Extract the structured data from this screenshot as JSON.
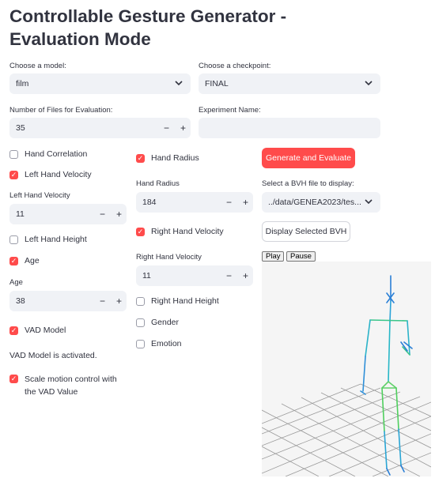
{
  "title": "Controllable Gesture Generator - Evaluation Mode",
  "model": {
    "label": "Choose a model:",
    "value": "film"
  },
  "checkpoint": {
    "label": "Choose a checkpoint:",
    "value": "FINAL"
  },
  "num_files": {
    "label": "Number of Files for Evaluation:",
    "value": "35"
  },
  "experiment": {
    "label": "Experiment Name:",
    "value": ""
  },
  "col1": {
    "hand_correlation": "Hand Correlation",
    "left_hand_velocity": "Left Hand Velocity",
    "left_hand_velocity_input_label": "Left Hand Velocity",
    "left_hand_velocity_value": "11",
    "left_hand_height": "Left Hand Height",
    "age": "Age",
    "age_input_label": "Age",
    "age_value": "38",
    "vad_model": "VAD Model",
    "vad_status": "VAD Model is activated.",
    "scale_line1": "Scale motion control with",
    "scale_line2": "the VAD Value"
  },
  "col2": {
    "hand_radius": "Hand Radius",
    "hand_radius_input_label": "Hand Radius",
    "hand_radius_value": "184",
    "right_hand_velocity": "Right Hand Velocity",
    "right_hand_velocity_input_label": "Right Hand Velocity",
    "right_hand_velocity_value": "11",
    "right_hand_height": "Right Hand Height",
    "gender": "Gender",
    "emotion": "Emotion"
  },
  "col3": {
    "generate_button": "Generate and Evaluate",
    "bvh_label": "Select a BVH file to display:",
    "bvh_value": "../data/GENEA2023/tes...",
    "display_button": "Display Selected BVH",
    "play": "Play",
    "pause": "Pause"
  },
  "icons": {
    "check": "✓",
    "chevron": "⌄",
    "minus": "−",
    "plus": "+"
  },
  "colors": {
    "accent": "#ff4b4b",
    "input_bg": "#f0f2f6",
    "text": "#31333f"
  }
}
